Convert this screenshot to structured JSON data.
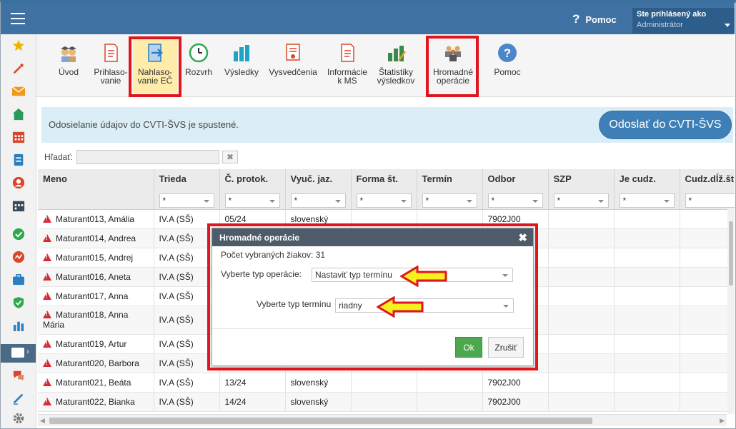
{
  "topbar": {
    "help_label": "Pomoc",
    "user_line1": "Ste prihlásený ako",
    "user_line2": "Administrátor"
  },
  "toolbar": {
    "items": [
      {
        "label": "Úvod"
      },
      {
        "label": "Prihlaso-\nvanie"
      },
      {
        "label": "Nahlaso-\nvanie EČ"
      },
      {
        "label": "Rozvrh"
      },
      {
        "label": "Výsledky"
      },
      {
        "label": "Vysvedčenia"
      },
      {
        "label": "Informácie\nk MS"
      },
      {
        "label": "Štatistiky\nvýsledkov"
      },
      {
        "label": "Hromadné\noperácie"
      },
      {
        "label": "Pomoc"
      }
    ]
  },
  "banner": {
    "text": "Odosielanie údajov do CVTI-ŠVS je spustené.",
    "button": "Odoslať do CVTI-ŠVS"
  },
  "search": {
    "label": "Hľadať:",
    "value": "",
    "clear": "✖"
  },
  "table": {
    "columns": [
      "Meno",
      "Trieda",
      "Č. protok.",
      "Vyuč. jaz.",
      "Forma št.",
      "Termín",
      "Odbor",
      "SZP",
      "Je cudz.",
      "Cudz.dĺž.št"
    ],
    "filter": "*",
    "rows": [
      {
        "name": "Maturant013, Amália",
        "trieda": "IV.A (SŠ)",
        "protok": "05/24",
        "jazyk": "slovenský",
        "odbor": "7902J00"
      },
      {
        "name": "Maturant014, Andrea",
        "trieda": "IV.A (SŠ)",
        "protok": "",
        "jazyk": "",
        "odbor": ""
      },
      {
        "name": "Maturant015, Andrej",
        "trieda": "IV.A (SŠ)",
        "protok": "",
        "jazyk": "",
        "odbor": ""
      },
      {
        "name": "Maturant016, Aneta",
        "trieda": "IV.A (SŠ)",
        "protok": "",
        "jazyk": "",
        "odbor": ""
      },
      {
        "name": "Maturant017, Anna",
        "trieda": "IV.A (SŠ)",
        "protok": "",
        "jazyk": "",
        "odbor": ""
      },
      {
        "name": "Maturant018, Anna Mária",
        "trieda": "IV.A (SŠ)",
        "protok": "",
        "jazyk": "",
        "odbor": ""
      },
      {
        "name": "Maturant019, Artur",
        "trieda": "IV.A (SŠ)",
        "protok": "",
        "jazyk": "",
        "odbor": ""
      },
      {
        "name": "Maturant020, Barbora",
        "trieda": "IV.A (SŠ)",
        "protok": "",
        "jazyk": "",
        "odbor": ""
      },
      {
        "name": "Maturant021, Beáta",
        "trieda": "IV.A (SŠ)",
        "protok": "13/24",
        "jazyk": "slovenský",
        "odbor": "7902J00"
      },
      {
        "name": "Maturant022, Bianka",
        "trieda": "IV.A (SŠ)",
        "protok": "14/24",
        "jazyk": "slovenský",
        "odbor": "7902J00"
      }
    ]
  },
  "modal": {
    "title": "Hromadné operácie",
    "close": "✖",
    "count_label": "Počet vybraných žiakov: 31",
    "op_label": "Vyberte typ operácie:",
    "op_value": "Nastaviť typ termínu",
    "term_label": "Vyberte typ termínu",
    "term_value": "riadny",
    "ok": "Ok",
    "cancel": "Zrušiť"
  },
  "colors": {
    "topbar": "#3f72a3",
    "highlight": "#e0161e",
    "accent_button": "#3f7fb7",
    "ok_button": "#4ca84c",
    "arrow": "#f5f01e"
  }
}
